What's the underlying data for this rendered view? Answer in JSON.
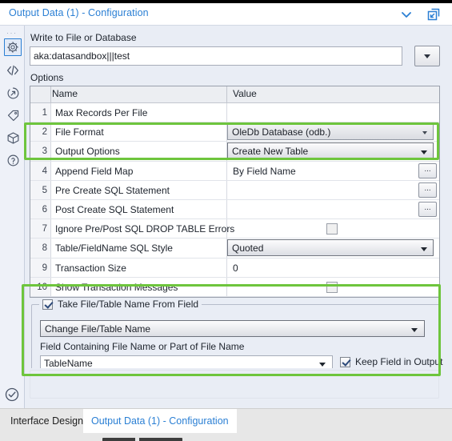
{
  "window": {
    "title": "Output Data (1) - Configuration",
    "chevron_icon": "chevron-down-icon",
    "expand_icon": "pop-out-icon"
  },
  "sidebar": {
    "dots": "···",
    "items": [
      {
        "icon": "gear-icon",
        "name": "configuration",
        "selected": true
      },
      {
        "icon": "code-icon",
        "name": "xml-view",
        "selected": false
      },
      {
        "icon": "annotation-arrow-icon",
        "name": "annotation",
        "selected": false
      },
      {
        "icon": "tag-icon",
        "name": "labels",
        "selected": false
      },
      {
        "icon": "package-icon",
        "name": "package",
        "selected": false
      },
      {
        "icon": "question-circle-icon",
        "name": "help",
        "selected": false
      }
    ],
    "status_icon": "check-circle-icon"
  },
  "config": {
    "write_label": "Write to File or Database",
    "path_value": "aka:datasandbox|||test",
    "options_label": "Options"
  },
  "grid": {
    "headers": {
      "num": "",
      "name": "Name",
      "value": "Value"
    },
    "rows": [
      {
        "num": "1",
        "name": "Max Records Per File",
        "value": "",
        "control": "text"
      },
      {
        "num": "2",
        "name": "File Format",
        "value": "OleDb Database (odb.)",
        "control": "combo-flat"
      },
      {
        "num": "3",
        "name": "Output Options",
        "value": "Create New Table",
        "control": "combo"
      },
      {
        "num": "4",
        "name": "Append Field Map",
        "value": "By Field Name",
        "control": "text-ellipsis"
      },
      {
        "num": "5",
        "name": "Pre Create SQL Statement",
        "value": "",
        "control": "text-ellipsis"
      },
      {
        "num": "6",
        "name": "Post Create SQL Statement",
        "value": "",
        "control": "text-ellipsis"
      },
      {
        "num": "7",
        "name": "Ignore Pre/Post SQL DROP TABLE Errors",
        "value": "",
        "control": "checkbox"
      },
      {
        "num": "8",
        "name": "Table/FieldName SQL Style",
        "value": "Quoted",
        "control": "combo"
      },
      {
        "num": "9",
        "name": "Transaction Size",
        "value": "0",
        "control": "text"
      },
      {
        "num": "10",
        "name": "Show Transaction Messages",
        "value": "",
        "control": "checkbox"
      }
    ],
    "ellipsis_label": "..."
  },
  "filename_group": {
    "title": "Take File/Table Name From Field",
    "title_checked": true,
    "mode_value": "Change File/Table Name",
    "field_label": "Field Containing File Name or Part of File Name",
    "field_value": "TableName",
    "keep_label": "Keep Field in Output",
    "keep_checked": true
  },
  "annotations": {
    "highlight_color": "#6ec53d",
    "regions": [
      "output-options-row",
      "take-file-table-name-group"
    ]
  },
  "tabs": {
    "designer": "Interface Designer",
    "config": "Output Data (1) - Configuration"
  }
}
